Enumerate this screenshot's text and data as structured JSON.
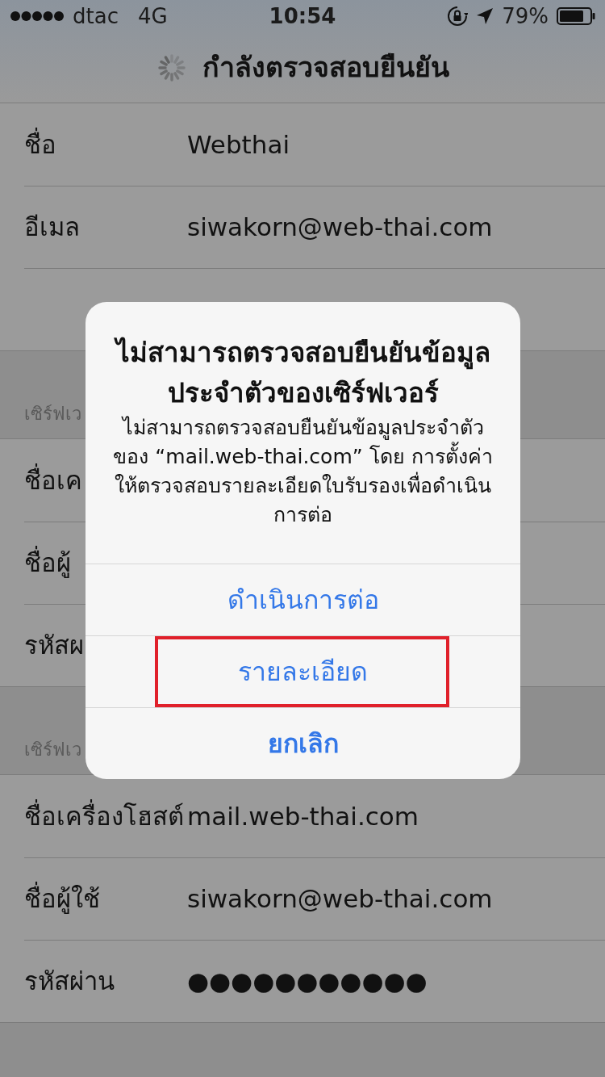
{
  "status_bar": {
    "carrier": "dtac",
    "network": "4G",
    "time": "10:54",
    "battery": "79%"
  },
  "nav": {
    "title": "กำลังตรวจสอบยืนยัน",
    "loading": true
  },
  "sections": [
    {
      "rows": [
        {
          "label": "ชื่อ",
          "value": "Webthai"
        },
        {
          "label": "อีเมล",
          "value": "siwakorn@web-thai.com"
        },
        {
          "kind": "covered"
        }
      ]
    },
    {
      "header": "เซิร์ฟเว",
      "rows": [
        {
          "label": "ชื่อเค"
        },
        {
          "label": "ชื่อผู้"
        },
        {
          "label": "รหัสผ"
        }
      ]
    },
    {
      "header": "เซิร์ฟเว",
      "rows": [
        {
          "label": "ชื่อเครื่องโฮสต์",
          "value": "mail.web-thai.com"
        },
        {
          "label": "ชื่อผู้ใช้",
          "value": "siwakorn@web-thai.com"
        },
        {
          "label": "รหัสผ่าน",
          "value": "●●●●●●●●●●●"
        }
      ]
    }
  ],
  "alert": {
    "title": "ไม่สามารถตรวจสอบยืนยันข้อมูลประจำตัวของเซิร์ฟเวอร์",
    "message": "ไม่สามารถตรวจสอบยืนยันข้อมูลประจำตัวของ “mail.web-thai.com” โดย การตั้งค่าให้ตรวจสอบรายละเอียดใบรับรองเพื่อดำเนินการต่อ",
    "buttons": [
      {
        "label": "ดำเนินการต่อ",
        "kind": "default",
        "highlighted": false
      },
      {
        "label": "รายละเอียด",
        "kind": "default",
        "highlighted": true
      },
      {
        "label": "ยกเลิก",
        "kind": "cancel",
        "highlighted": false
      }
    ]
  }
}
